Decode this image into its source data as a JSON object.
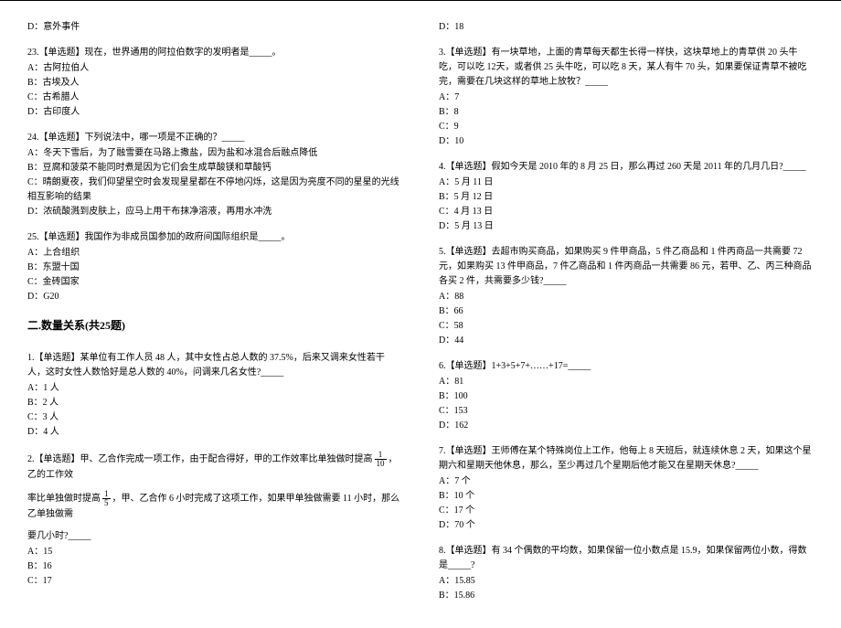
{
  "left": {
    "q22_partial_option": "D：意外事件",
    "q23": {
      "text": "23.【单选题】现在，世界通用的阿拉伯数字的发明者是_____。",
      "A": "A：古阿拉伯人",
      "B": "B：古埃及人",
      "C": "C：古希腊人",
      "D": "D：古印度人"
    },
    "q24": {
      "text": "24.【单选题】下列说法中，哪一项是不正确的？_____",
      "A": "A：冬天下雪后，为了融雪要在马路上撒盐，因为盐和冰混合后融点降低",
      "B": "B：豆腐和菠菜不能同时煮是因为它们会生成草酸镁和草酸钙",
      "C": "C：晴朗夏夜，我们仰望星空时会发现星星都在不停地闪烁，这是因为亮度不同的星星的光线相互影响的结果",
      "D": "D：浓硫酸溅到皮肤上，应马上用干布抹净溶液，再用水冲洗"
    },
    "q25": {
      "text": "25.【单选题】我国作为非成员国参加的政府间国际组织是_____。",
      "A": "A：上合组织",
      "B": "B：东盟十国",
      "C": "C：金砖国家",
      "D": "D：G20"
    },
    "section": "二.数量关系(共25题)",
    "q1": {
      "text": "1.【单选题】某单位有工作人员 48 人，其中女性占总人数的 37.5%，后来又调来女性若干人，这时女性人数恰好是总人数的 40%，问调来几名女性?_____",
      "A": "A：1 人",
      "B": "B：2 人",
      "C": "C：3 人",
      "D": "D：4 人"
    },
    "q2": {
      "line1a": "2.【单选题】甲、乙合作完成一项工作，由于配合得好，甲的工作效率比单独做时提高",
      "line1b": "，乙的工作效",
      "line2a": "率比单独做时提高",
      "line2b": "，甲、乙合作 6 小时完成了这项工作，如果甲单独做需要 11 小时，那么乙单独做需",
      "line3": "要几小时?_____",
      "A": "A：15",
      "B": "B：16",
      "C": "C：17"
    }
  },
  "right": {
    "q2_d": "D：18",
    "q3": {
      "text": "3.【单选题】有一块草地，上面的青草每天都生长得一样快，这块草地上的青草供 20 头牛吃，可以吃 12天，或者供 25 头牛吃，可以吃 8 天，某人有牛 70 头，如果要保证青草不被吃完，需要在几块这样的草地上放牧？_____",
      "A": "A：7",
      "B": "B：8",
      "C": "C：9",
      "D": "D：10"
    },
    "q4": {
      "text": "4.【单选题】假如今天是 2010 年的 8 月 25 日，那么再过 260 天是 2011 年的几月几日?_____",
      "A": "A：5 月 11 日",
      "B": "B：5 月 12 日",
      "C": "C：4 月 13 日",
      "D": "D：5 月 13 日"
    },
    "q5": {
      "text": "5.【单选题】去超市购买商品，如果购买 9 件甲商品，5 件乙商品和 1 件丙商品一共需要 72 元，如果购买 13 件甲商品，7 件乙商品和 1 件丙商品一共需要 86 元，若甲、乙、丙三种商品各买 2 件，共需要多少钱?_____",
      "A": "A：88",
      "B": "B：66",
      "C": "C：58",
      "D": "D：44"
    },
    "q6": {
      "text": "6.【单选题】1+3+5+7+……+17=_____",
      "A": "A：81",
      "B": "B：100",
      "C": "C：153",
      "D": "D：162"
    },
    "q7": {
      "text": "7.【单选题】王师傅在某个特殊岗位上工作，他每上 8 天班后，就连续休息 2 天，如果这个星期六和星期天他休息，那么，至少再过几个星期后他才能又在星期天休息?_____",
      "A": "A：7 个",
      "B": "B：10 个",
      "C": "C：17 个",
      "D": "D：70 个"
    },
    "q8": {
      "text": "8.【单选题】有 34 个偶数的平均数，如果保留一位小数点是 15.9，如果保留两位小数，得数是_____?",
      "A": "A：15.85",
      "B": "B：15.86"
    }
  }
}
